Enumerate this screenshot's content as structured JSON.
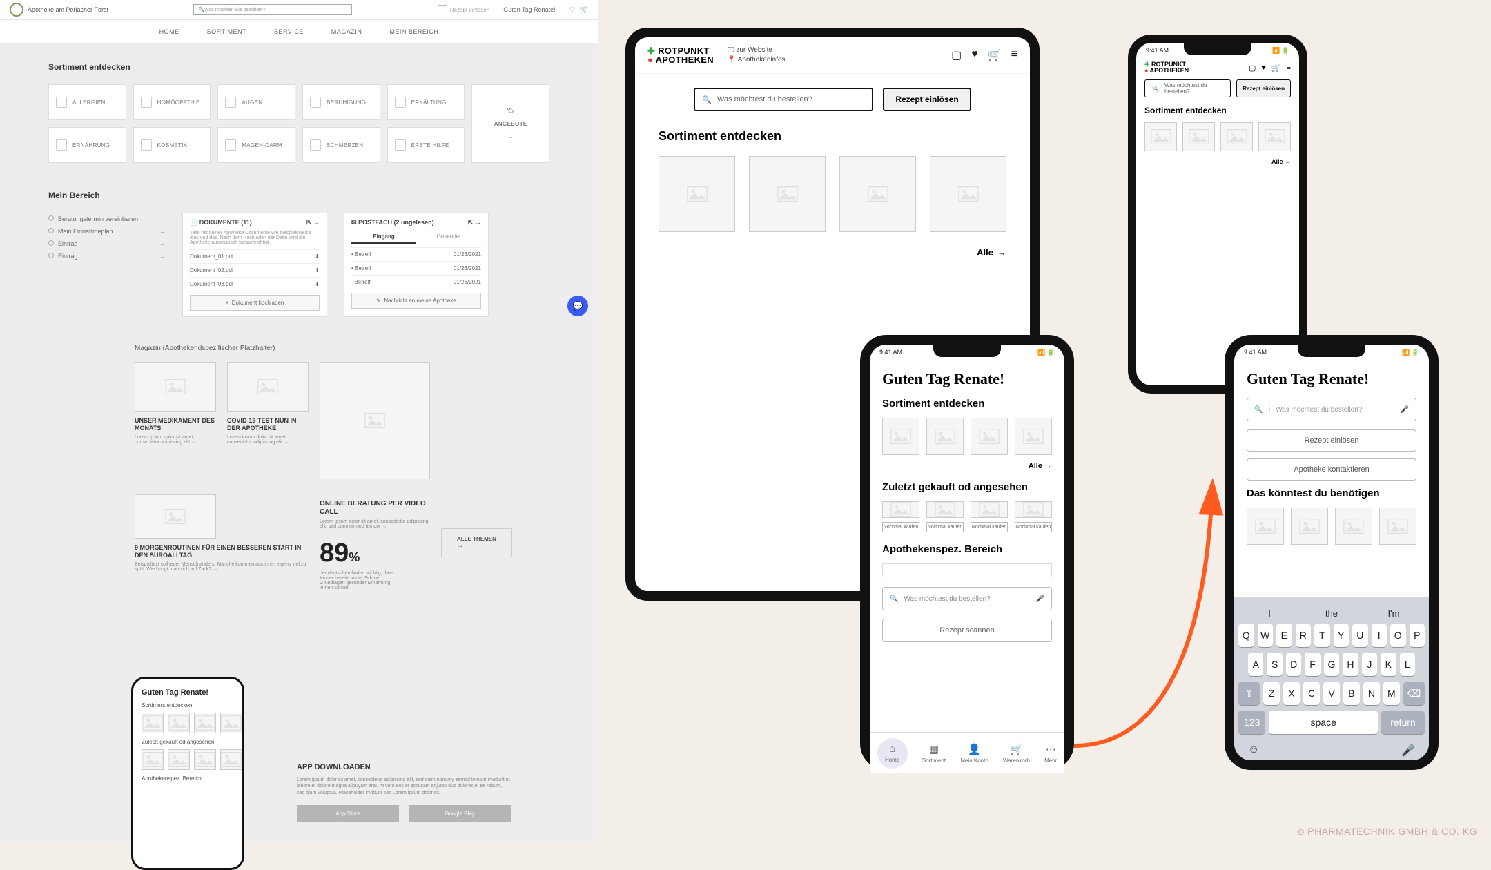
{
  "desktop": {
    "logo": "Apotheke\nam Perlacher Forst",
    "search_placeholder": "Was möchten Sie bestellen?",
    "recipe": "Rezept einlösen",
    "greeting": "Guten Tag Renate!",
    "nav": [
      "HOME",
      "SORTIMENT",
      "SERVICE",
      "MAGAZIN",
      "MEIN BEREICH"
    ],
    "sortiment_title": "Sortiment entdecken",
    "cats": [
      "ALLERGIEN",
      "HOMÖOPATHIE",
      "AUGEN",
      "BERUHIGUNG",
      "ERKÄLTUNG",
      "ERNÄHRUNG",
      "KOSMETIK",
      "MAGEN-DARM",
      "SCHMERZEN",
      "ERSTE HILFE"
    ],
    "angebote": "ANGEBOTE",
    "mein_title": "Mein Bereich",
    "mein_links": [
      "Beratungstermin vereinbaren",
      "Mein Einnahmeplan",
      "Eintrag",
      "Eintrag"
    ],
    "dokumente_title": "DOKUMENTE (11)",
    "dokumente_hint": "Teile mit deiner Apotheke Dokumente wie beispielsweise dies und das. Nach dem Hochladen der Datei wird die Apotheke automatisch benachrichtigt.",
    "dokumente": [
      "Dokument_01.pdf",
      "Dokument_02.pdf",
      "Dokument_03.pdf"
    ],
    "doc_upload": "Dokument hochladen",
    "postfach_title": "POSTFACH (2 ungelesen)",
    "postfach_tabs": [
      "Eingang",
      "Gesendet"
    ],
    "postfach_rows": [
      {
        "s": "Betreff",
        "d": "01/26/2021"
      },
      {
        "s": "Betreff",
        "d": "01/26/2021"
      },
      {
        "s": "Betreff",
        "d": "01/26/2021"
      }
    ],
    "postfach_send": "Nachricht an meine Apotheke",
    "mag_title": "Magazin (Apothekendspezifischer Platzhalter)",
    "mag": [
      {
        "t": "UNSER MEDIKAMENT DES MONATS",
        "p": "Lorem ipsum dolor sit amet, consectetur adipiscing elit →"
      },
      {
        "t": "COVID-19 TEST NUN IN DER APOTHEKE",
        "p": "Lorem ipsum dolor sit amet, consectetur adipiscing elit →"
      }
    ],
    "mag2_t": "9 MORGENROUTINEN FÜR EINEN BESSEREN START IN DEN BÜROALLTAG",
    "mag2_p": "Beispieltext soll jeder Mensch anders. Manche kommen aus ihren eigens viel zu spät. Wie bringt man sich auf Zack? →",
    "online_t": "ONLINE BERATUNG PER VIDEO CALL",
    "online_p": "Lorem ipsum dolor sit amet, consectetur adipiscing elit, sed diam eirmod tempor →",
    "stat": "89",
    "stat_unit": "%",
    "stat_p": "der deutschen finden wichtig, dass Kinder bereits in der Schule Grundlagen gesunder Ernährung lernen sollten.",
    "alle_themen": "ALLE THEMEN",
    "phone_prev": {
      "greet": "Guten Tag Renate!",
      "s1": "Sortiment entdecken",
      "s2": "Zuletzt gekauft od angesehen",
      "s3": "Apothekenspez. Bereich"
    },
    "app_dl": {
      "t": "APP DOWNLOADEN",
      "p": "Lorem ipsum dolor sit amet, consectetur adipiscing elit, sed diam nonumy eirmod tempor invidunt ut labore et dolore magna aliquyam erat. At vero eos et accusam et justo duo dolores et ea rebum, sed diam voluptua. Placeholder invidunt sed Lorem ipsum dolor sit.",
      "b1": "App Store",
      "b2": "Google Play"
    }
  },
  "tablet": {
    "brand_l1": "ROTPUNKT",
    "brand_l2": "APOTHEKEN",
    "link1": "zur Website",
    "link2": "Apothekeninfos",
    "search_placeholder": "Was möchtest du bestellen?",
    "recipe": "Rezept einlösen",
    "sortiment": "Sortiment entdecken",
    "alle": "Alle"
  },
  "phone_s": {
    "time": "9:41 AM",
    "brand_l1": "ROTPUNKT",
    "brand_l2": "APOTHEKEN",
    "search_placeholder": "Was möchtest du bestellen?",
    "recipe": "Rezept einlösen",
    "sortiment": "Sortiment entdecken",
    "alle": "Alle →"
  },
  "phone_a": {
    "time": "9:41 AM",
    "greet": "Guten Tag Renate!",
    "sortiment": "Sortiment entdecken",
    "alle": "Alle →",
    "zuletzt": "Zuletzt gekauft od angesehen",
    "buy": "Nochmal kaufen",
    "apo": "Apothekenspez. Bereich",
    "search_placeholder": "Was möchtest du bestellen?",
    "scan": "Rezept scannen",
    "nav": [
      "Home",
      "Sortiment",
      "Mein Konto",
      "Warenkorb",
      "Mehr"
    ]
  },
  "phone_b": {
    "time": "9:41 AM",
    "greet": "Guten Tag Renate!",
    "search_placeholder": "Was möchtest du bestellen?",
    "b1": "Rezept einlösen",
    "b2": "Apotheke kontaktieren",
    "section": "Das könntest du benötigen",
    "sug": [
      "I",
      "the",
      "I'm"
    ],
    "rows": [
      [
        "Q",
        "W",
        "E",
        "R",
        "T",
        "Y",
        "U",
        "I",
        "O",
        "P"
      ],
      [
        "A",
        "S",
        "D",
        "F",
        "G",
        "H",
        "J",
        "K",
        "L"
      ],
      [
        "⇧",
        "Z",
        "X",
        "C",
        "V",
        "B",
        "N",
        "M",
        "⌫"
      ]
    ],
    "bottom": [
      "123",
      "space",
      "return"
    ]
  },
  "credit": "© PHARMATECHNIK GMBH & CO. KG"
}
